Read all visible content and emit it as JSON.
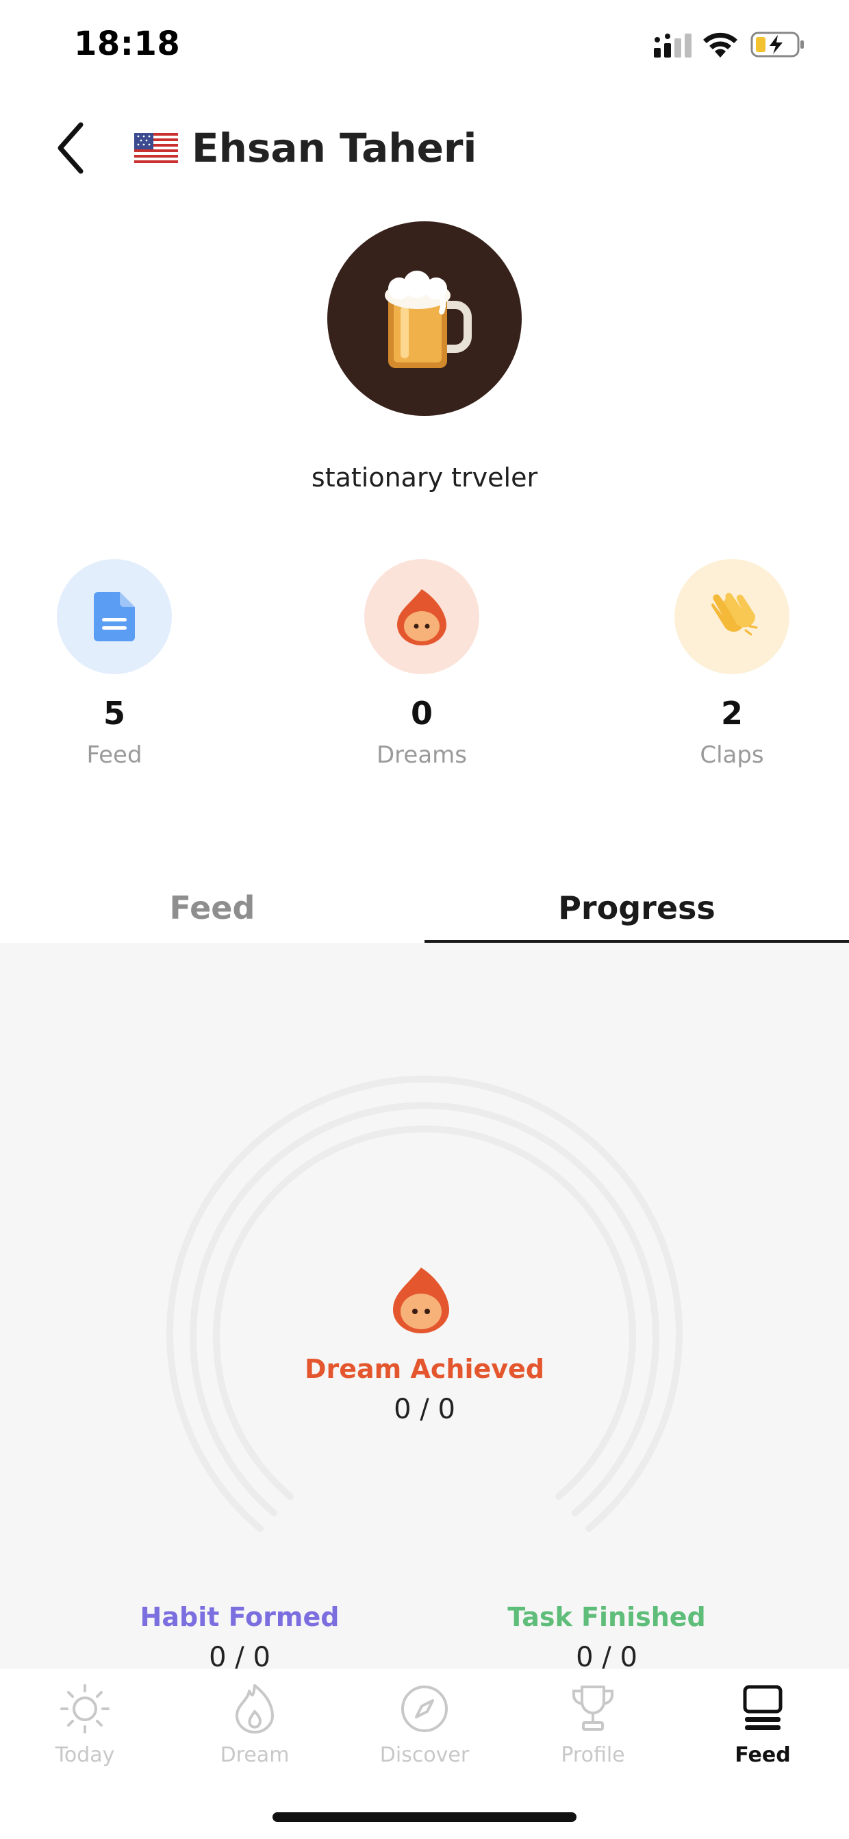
{
  "status_bar": {
    "time": "18:18"
  },
  "header": {
    "flag_icon": "us-flag-icon",
    "name": "Ehsan Taheri"
  },
  "profile": {
    "avatar_icon": "beer-mug-icon",
    "avatar_bg": "#37211b",
    "bio": "stationary trveler"
  },
  "stats": [
    {
      "value": "5",
      "label": "Feed",
      "icon": "document-icon",
      "bg": "#e3eefc"
    },
    {
      "value": "0",
      "label": "Dreams",
      "icon": "dream-flame-icon",
      "bg": "#fbe3da"
    },
    {
      "value": "2",
      "label": "Claps",
      "icon": "clap-icon",
      "bg": "#fdf0d6"
    }
  ],
  "tabs": [
    {
      "label": "Feed",
      "active": false
    },
    {
      "label": "Progress",
      "active": true
    }
  ],
  "progress": {
    "dream": {
      "label": "Dream Achieved",
      "count": "0 / 0",
      "color": "#e4572e"
    },
    "habit": {
      "label": "Habit Formed",
      "count": "0 / 0",
      "color": "#7b6fe0"
    },
    "task": {
      "label": "Task Finished",
      "count": "0 / 0",
      "color": "#5fbd7a"
    }
  },
  "bottom_nav": [
    {
      "label": "Today",
      "icon": "sun-icon",
      "active": false
    },
    {
      "label": "Dream",
      "icon": "flame-icon",
      "active": false
    },
    {
      "label": "Discover",
      "icon": "compass-icon",
      "active": false
    },
    {
      "label": "Profile",
      "icon": "trophy-icon",
      "active": false
    },
    {
      "label": "Feed",
      "icon": "feed-icon",
      "active": true
    }
  ]
}
